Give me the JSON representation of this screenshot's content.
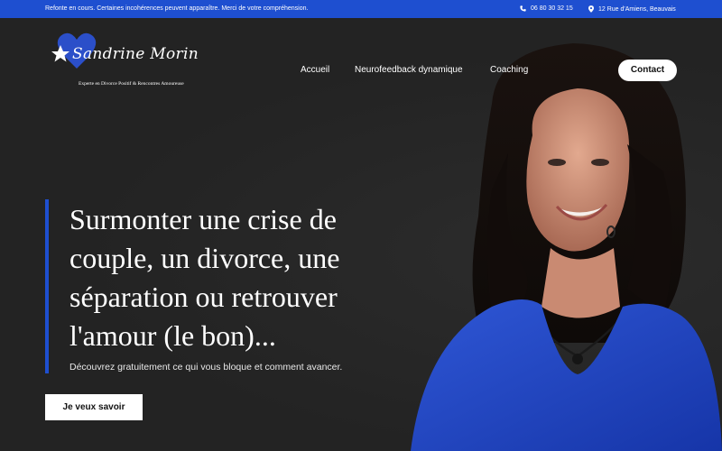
{
  "topbar": {
    "notice": "Refonte en cours. Certaines incohérences peuvent apparaître. Merci de votre compréhension.",
    "phone": "06 80 30 32 15",
    "address": "12 Rue d'Amiens, Beauvais",
    "icons": [
      "phone-icon",
      "location-pin-icon"
    ]
  },
  "logo": {
    "name": "Sandrine Morin",
    "tagline": "Experte en Divorce Positif & Rencontres Amoureuse",
    "colors": {
      "heart": "#2b4fc9",
      "star": "#ffffff"
    }
  },
  "nav": {
    "items": [
      {
        "label": "Accueil"
      },
      {
        "label": "Neurofeedback dynamique"
      },
      {
        "label": "Coaching"
      }
    ],
    "contact_label": "Contact"
  },
  "hero": {
    "headline": "Surmonter une crise de couple, un divorce, une séparation ou retrouver l'amour (le bon)...",
    "subline": "Découvrez gratuitement ce qui vous bloque et comment avancer.",
    "cta_label": "Je veux savoir"
  },
  "colors": {
    "accent": "#1e4fd0",
    "background": "#232323",
    "text": "#ffffff"
  }
}
